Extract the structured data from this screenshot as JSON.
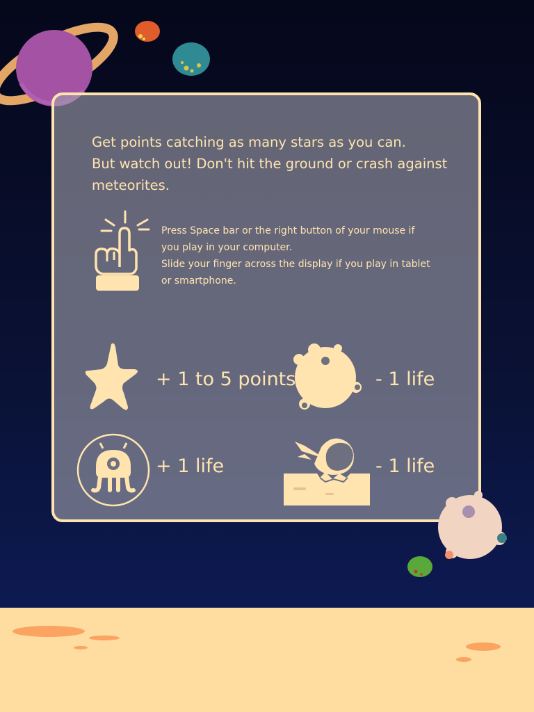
{
  "instructions": {
    "intro_line1": "Get points catching as many stars as you can.",
    "intro_line2": "But watch out! Don't hit the ground or crash against",
    "intro_line3": "meteorites.",
    "controls_line1": "Press Space bar or the right button of your mouse if",
    "controls_line2": "you play in your computer.",
    "controls_line3": "Slide your finger across the display if you play in tablet",
    "controls_line4": "or smartphone."
  },
  "legend": {
    "star": "+ 1 to 5 points",
    "meteorite": "- 1 life",
    "alien": "+ 1 life",
    "crash": "- 1 life"
  },
  "colors": {
    "text": "#ffe4b0",
    "panel_border": "#ffe4b0",
    "ground": "#ffdda0",
    "crater": "#fba461",
    "space_top": "#05071a",
    "space_bottom": "#0d1a52"
  }
}
